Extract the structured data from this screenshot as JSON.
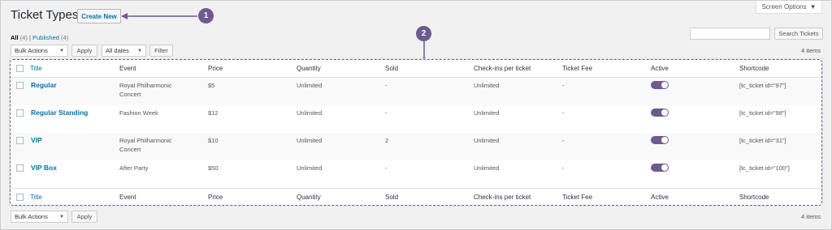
{
  "header": {
    "title": "Ticket Types",
    "create_new_label": "Create New",
    "screen_options_label": "Screen Options"
  },
  "callouts": [
    "1",
    "2"
  ],
  "views": {
    "all_label": "All",
    "all_count": "(4)",
    "separator": "|",
    "published_label": "Published",
    "published_count": "(4)"
  },
  "search": {
    "placeholder": "",
    "button_label": "Search Tickets"
  },
  "tablenav_top": {
    "bulk_actions": "Bulk Actions",
    "apply_label": "Apply",
    "dates_label": "All dates",
    "filter_label": "Filter",
    "items_count": "4 items"
  },
  "tablenav_bottom": {
    "bulk_actions": "Bulk Actions",
    "apply_label": "Apply",
    "items_count": "4 items"
  },
  "columns": [
    "Title",
    "Event",
    "Price",
    "Quantity",
    "Sold",
    "Check-ins per ticket",
    "Ticket Fee",
    "Active",
    "Shortcode"
  ],
  "rows": [
    {
      "title": "Regular",
      "event_line1": "Royal Philharmonic",
      "event_line2": "Concert",
      "price": "$5",
      "quantity": "Unlimited",
      "sold": "-",
      "checkins": "Unlimited",
      "fee": "-",
      "active": true,
      "shortcode": "[tc_ticket id=\"97\"]"
    },
    {
      "title": "Regular Standing",
      "event_line1": "Fashion Week",
      "event_line2": "",
      "price": "$12",
      "quantity": "Unlimited",
      "sold": "-",
      "checkins": "Unlimited",
      "fee": "-",
      "active": true,
      "shortcode": "[tc_ticket id=\"98\"]"
    },
    {
      "title": "VIP",
      "event_line1": "Royal Philharmonic",
      "event_line2": "Concert",
      "price": "$10",
      "quantity": "Unlimited",
      "sold": "2",
      "checkins": "Unlimited",
      "fee": "-",
      "active": true,
      "shortcode": "[tc_ticket id=\"31\"]"
    },
    {
      "title": "VIP Box",
      "event_line1": "After Party",
      "event_line2": "",
      "price": "$50",
      "quantity": "Unlimited",
      "sold": "-",
      "checkins": "Unlimited",
      "fee": "-",
      "active": true,
      "shortcode": "[tc_ticket id=\"100\"]"
    }
  ],
  "colors": {
    "accent": "#6b5b8e",
    "link": "#0073aa"
  }
}
